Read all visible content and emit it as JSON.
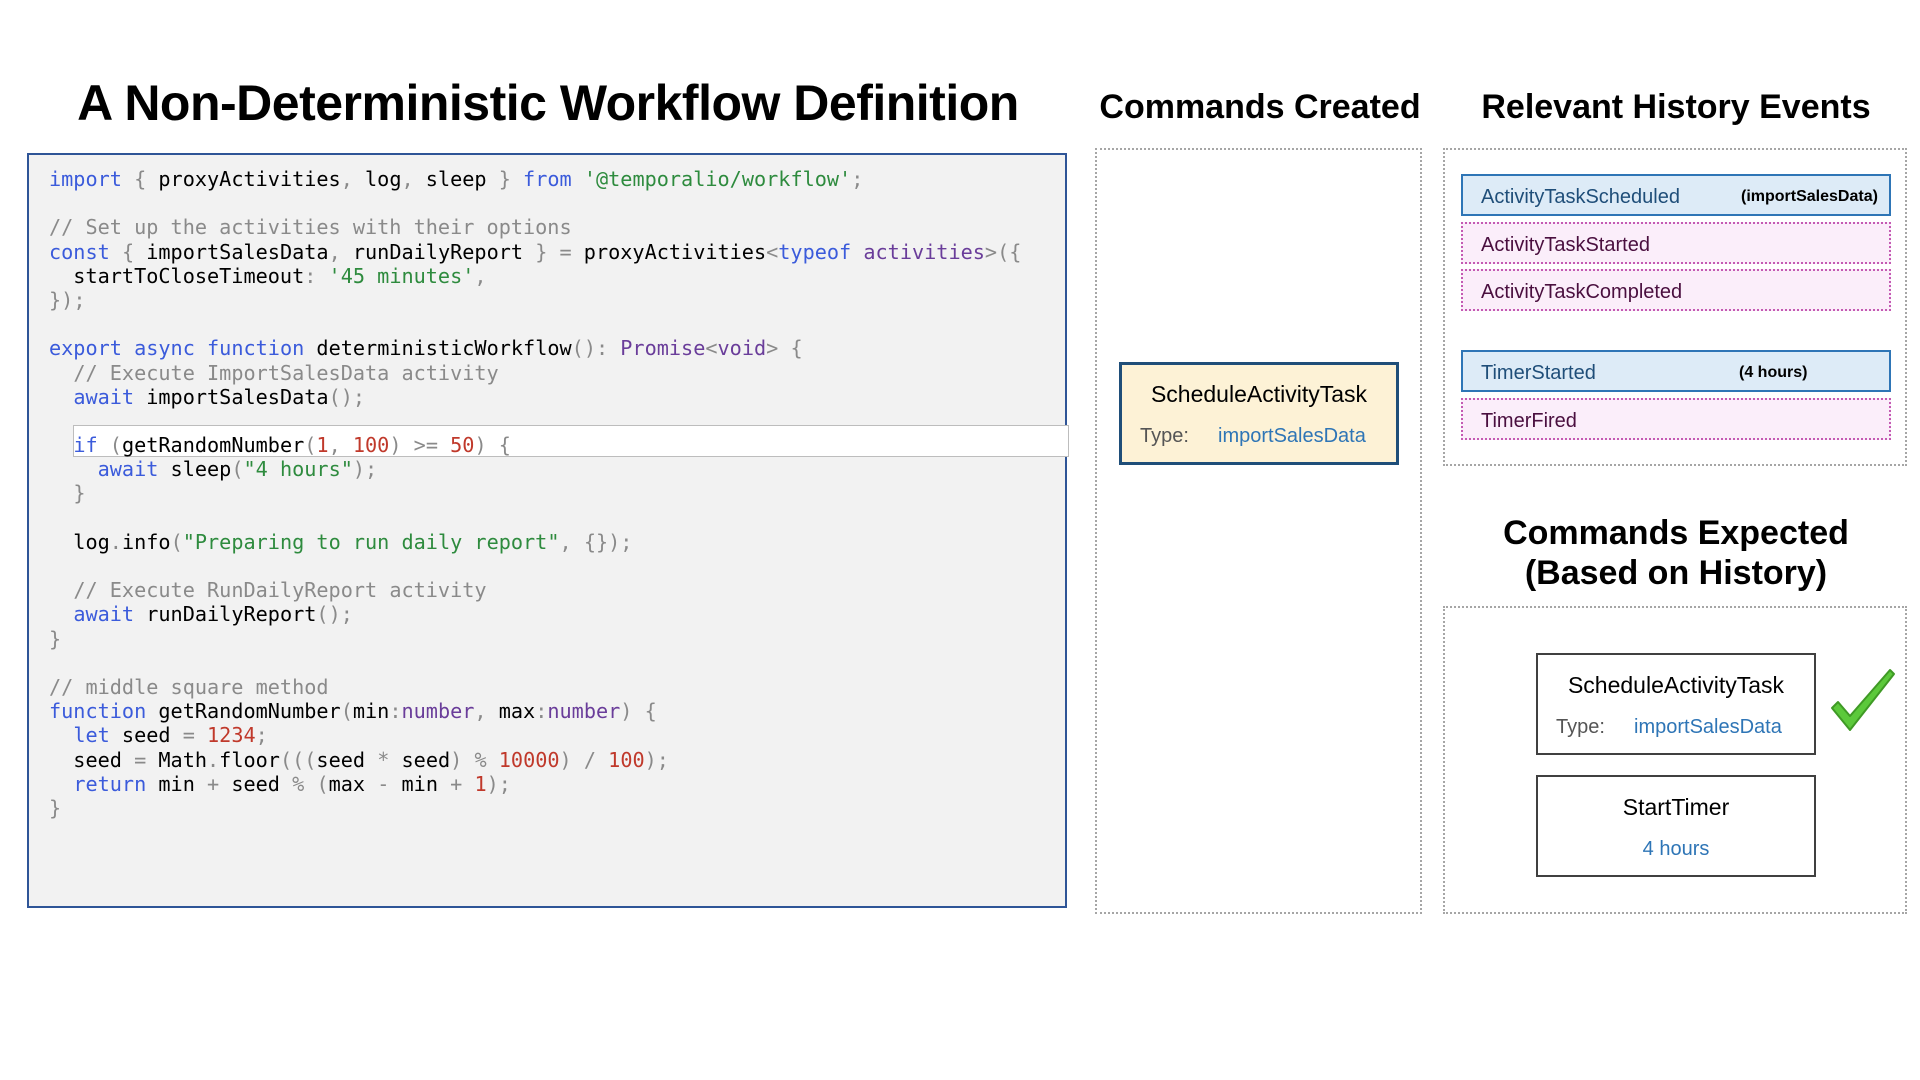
{
  "titles": {
    "main": "A Non-Deterministic Workflow Definition",
    "commands_created": "Commands Created",
    "history_events": "Relevant History Events",
    "commands_expected_line1": "Commands Expected",
    "commands_expected_line2": "(Based on History)"
  },
  "code_lines": [
    "import { proxyActivities, log, sleep } from '@temporalio/workflow';",
    "",
    "// Set up the activities with their options",
    "const { importSalesData, runDailyReport } = proxyActivities<typeof activities>({",
    "  startToCloseTimeout: '45 minutes',",
    "});",
    "",
    "export async function deterministicWorkflow(): Promise<void> {",
    "  // Execute ImportSalesData activity",
    "  await importSalesData();",
    "",
    "  if (getRandomNumber(1, 100) >= 50) {",
    "    await sleep(\"4 hours\");",
    "  }",
    "",
    "  log.info(\"Preparing to run daily report\", {});",
    "",
    "  // Execute RunDailyReport activity",
    "  await runDailyReport();",
    "}",
    "",
    "// middle square method",
    "function getRandomNumber(min:number, max:number) {",
    "  let seed = 1234;",
    "  seed = Math.floor(((seed * seed) % 10000) / 100);",
    "  return min + seed % (max - min + 1);",
    "}"
  ],
  "highlighted_line_index": 11,
  "commands_created": [
    {
      "name": "ScheduleActivityTask",
      "type_label": "Type:",
      "type_value": "importSalesData"
    }
  ],
  "history_events": [
    {
      "name": "ActivityTaskScheduled",
      "note": "(importSalesData)",
      "style": "blue"
    },
    {
      "name": "ActivityTaskStarted",
      "note": "",
      "style": "pink"
    },
    {
      "name": "ActivityTaskCompleted",
      "note": "",
      "style": "pink"
    },
    {
      "name": "TimerStarted",
      "note": "(4 hours)",
      "style": "blue"
    },
    {
      "name": "TimerFired",
      "note": "",
      "style": "pink"
    }
  ],
  "commands_expected": [
    {
      "name": "ScheduleActivityTask",
      "type_label": "Type:",
      "type_value": "importSalesData",
      "matched": true
    },
    {
      "name": "StartTimer",
      "value": "4 hours"
    }
  ],
  "icons": {
    "match": "green-checkmark-icon"
  },
  "colors": {
    "code_border": "#2f5597",
    "created_card_bg": "#fdf2d6",
    "event_blue": "#2e75b6",
    "event_pink": "#c45ab3",
    "checkmark": "#5cc93b",
    "type_value": "#2e75b6"
  }
}
